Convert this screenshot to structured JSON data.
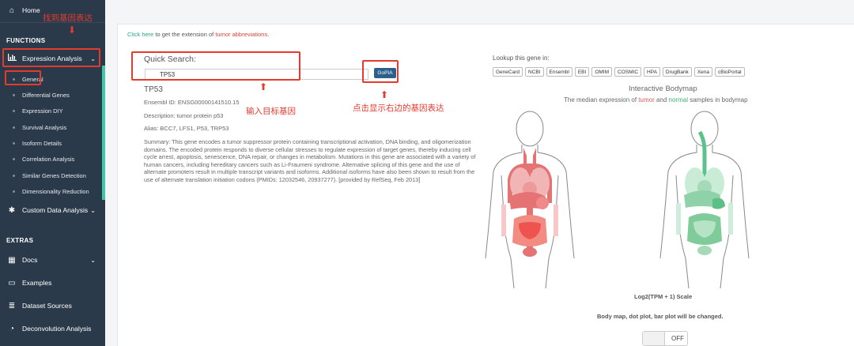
{
  "sidebar": {
    "home": "Home",
    "functions_heading": "FUNCTIONS",
    "expression_analysis": "Expression Analysis",
    "sub_items": [
      "General",
      "Differential Genes",
      "Expression DIY",
      "Survival Analysis",
      "Isoform Details",
      "Correlation Analysis",
      "Similar Genes Detection",
      "Dimensionality Reduction"
    ],
    "custom_data": "Custom Data Analysis",
    "extras_heading": "EXTRAS",
    "docs": "Docs",
    "examples": "Examples",
    "dataset_sources": "Dataset Sources",
    "deconvolution": "Deconvolution Analysis",
    "accent_color": "#3cc8a0"
  },
  "hint": {
    "link": "Click here",
    "mid": " to get the extension of ",
    "red": "tumor abbreviations",
    "end": "."
  },
  "search": {
    "label": "Quick Search:",
    "value": "TP53",
    "button": "GoPIA"
  },
  "gene": {
    "name": "TP53",
    "ensembl": "Ensembl ID: ENSG00000141510.15",
    "description": "Description: tumor protein p53",
    "alias": "Alias: BCC7, LFS1, P53, TRP53",
    "summary": "Summary: This gene encodes a tumor suppressor protein containing transcriptional activation, DNA binding, and oligomerization domains. The encoded protein responds to diverse cellular stresses to regulate expression of target genes, thereby inducing cell cycle arrest, apoptosis, senescence, DNA repair, or changes in metabolism. Mutations in this gene are associated with a variety of human cancers, including hereditary cancers such as Li-Fraumeni syndrome. Alternative splicing of this gene and the use of alternate promoters result in multiple transcript variants and isoforms. Additional isoforms have also been shown to result from the use of alternate translation initiation codons (PMIDs: 12032546, 20937277). [provided by RefSeq, Feb 2013]"
  },
  "annotations": {
    "find_gene": "找到基因表达",
    "enter_gene": "输入目标基因",
    "click_show": "点击显示右边的基因表达"
  },
  "lookup": {
    "label": "Lookup this gene in:",
    "links": [
      "GeneCard",
      "NCBI",
      "Ensembl",
      "EBI",
      "OMIM",
      "COSMIC",
      "HPA",
      "DrugBank",
      "Xena",
      "cBioPortal"
    ]
  },
  "bodymap": {
    "title": "Interactive Bodymap",
    "sub_pre": "The median expression of ",
    "sub_tumor": "tumor",
    "sub_and": " and ",
    "sub_normal": "normal",
    "sub_post": " samples in bodymap",
    "scale": "Log2(TPM + 1) Scale",
    "changed": "Body map, dot plot, bar plot will be changed.",
    "toggle": "OFF",
    "tumor_color": "#e05a5a",
    "normal_color": "#3cb371"
  }
}
